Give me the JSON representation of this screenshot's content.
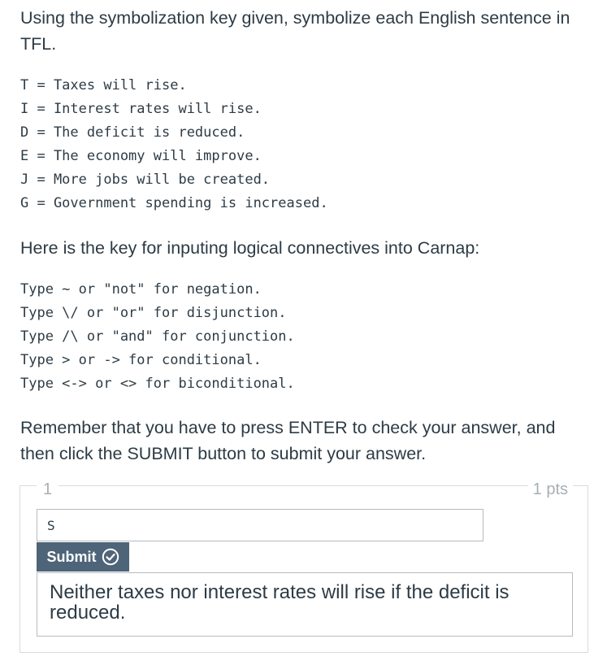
{
  "intro_text": "Using the symbolization key given, symbolize each English sentence in TFL.",
  "symbolization_key": [
    "T = Taxes will rise.",
    "I = Interest rates will rise.",
    "D = The deficit is reduced.",
    "E = The economy will improve.",
    "J = More jobs will be created.",
    "G = Government spending is increased."
  ],
  "connectives_intro": "Here is the key for inputing logical connectives into Carnap:",
  "connectives": [
    "Type ~ or \"not\" for negation.",
    "Type \\/ or \"or\" for disjunction.",
    "Type /\\ or \"and\" for conjunction.",
    "Type > or -> for conditional.",
    "Type <-> or <> for biconditional."
  ],
  "reminder_text": "Remember that you have to press ENTER to check your answer, and then click the SUBMIT button to submit your answer.",
  "question": {
    "number": "1",
    "points": "1 pts",
    "answer_value": "S",
    "submit_label": "Submit",
    "submit_icon": "check-circle-icon",
    "prompt": "Neither taxes nor interest rates will rise if the deficit is reduced."
  },
  "colors": {
    "text": "#2d3b45",
    "muted": "#a7afb5",
    "button_bg": "#4e6478",
    "border": "#b5bcc1"
  }
}
